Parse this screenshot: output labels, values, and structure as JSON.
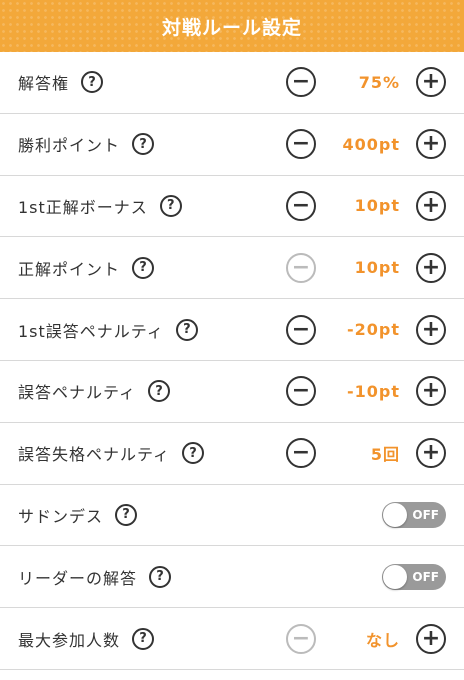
{
  "header": {
    "title": "対戦ルール設定"
  },
  "rows": [
    {
      "label": "解答権",
      "value": "75%"
    },
    {
      "label": "勝利ポイント",
      "value": "400pt"
    },
    {
      "label": "1st正解ボーナス",
      "value": "10pt"
    },
    {
      "label": "正解ポイント",
      "value": "10pt",
      "minus_disabled": true
    },
    {
      "label": "1st誤答ペナルティ",
      "value": "-20pt"
    },
    {
      "label": "誤答ペナルティ",
      "value": "-10pt"
    },
    {
      "label": "誤答失格ペナルティ",
      "value": "5回"
    },
    {
      "label": "サドンデス",
      "toggle": "OFF"
    },
    {
      "label": "リーダーの解答",
      "toggle": "OFF"
    },
    {
      "label": "最大参加人数",
      "value": "なし",
      "minus_disabled": true
    }
  ],
  "help_glyph": "?",
  "minus_glyph": "−",
  "plus_glyph": "+",
  "colors": {
    "header": "#f3a83a",
    "value": "#f2932c",
    "toggle_off": "#9a9a9a"
  }
}
